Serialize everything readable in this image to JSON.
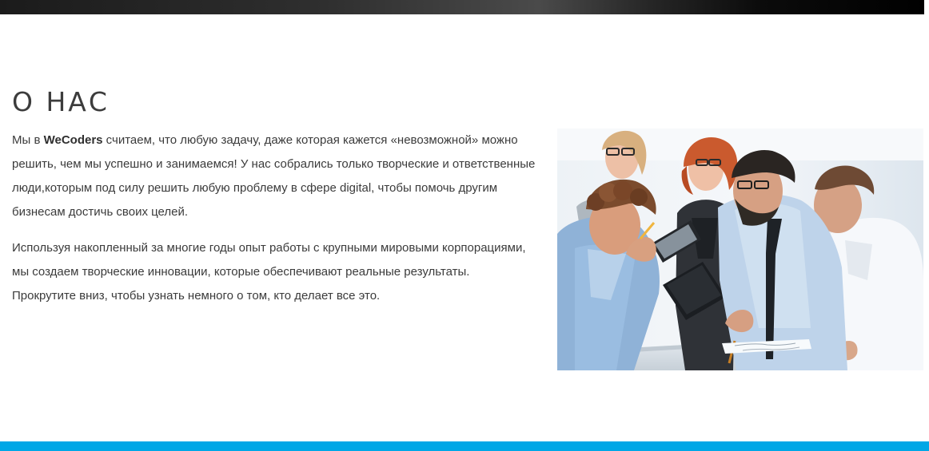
{
  "about": {
    "title": "О НАС",
    "brand": "WeCoders",
    "p1_before": "Мы в ",
    "p1_after": " считаем, что любую задачу, даже которая кажется «невозможной» можно решить, чем мы успешно и занимаемся! У нас собрались только творческие и ответственные люди,которым под силу решить любую проблему в сфере digital, чтобы помочь другим бизнесам достичь своих целей.",
    "p2": "Используя накопленный за многие годы опыт работы с крупными мировыми корпорациями, мы создаем творческие инновации, которые обеспечивают реальные результаты.",
    "p3": "Прокрутите вниз, чтобы узнать немного о том, кто делает все это."
  },
  "colors": {
    "accent": "#00a7e6",
    "text": "#3b3b3b",
    "top_strip": "#1b1b1b"
  }
}
